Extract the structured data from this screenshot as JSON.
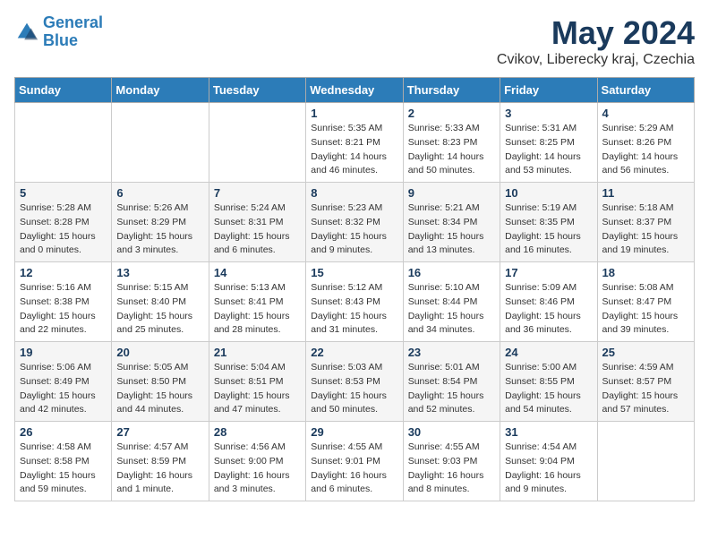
{
  "header": {
    "logo_line1": "General",
    "logo_line2": "Blue",
    "month": "May 2024",
    "location": "Cvikov, Liberecky kraj, Czechia"
  },
  "days_of_week": [
    "Sunday",
    "Monday",
    "Tuesday",
    "Wednesday",
    "Thursday",
    "Friday",
    "Saturday"
  ],
  "weeks": [
    [
      {
        "day": "",
        "info": ""
      },
      {
        "day": "",
        "info": ""
      },
      {
        "day": "",
        "info": ""
      },
      {
        "day": "1",
        "info": "Sunrise: 5:35 AM\nSunset: 8:21 PM\nDaylight: 14 hours\nand 46 minutes."
      },
      {
        "day": "2",
        "info": "Sunrise: 5:33 AM\nSunset: 8:23 PM\nDaylight: 14 hours\nand 50 minutes."
      },
      {
        "day": "3",
        "info": "Sunrise: 5:31 AM\nSunset: 8:25 PM\nDaylight: 14 hours\nand 53 minutes."
      },
      {
        "day": "4",
        "info": "Sunrise: 5:29 AM\nSunset: 8:26 PM\nDaylight: 14 hours\nand 56 minutes."
      }
    ],
    [
      {
        "day": "5",
        "info": "Sunrise: 5:28 AM\nSunset: 8:28 PM\nDaylight: 15 hours\nand 0 minutes."
      },
      {
        "day": "6",
        "info": "Sunrise: 5:26 AM\nSunset: 8:29 PM\nDaylight: 15 hours\nand 3 minutes."
      },
      {
        "day": "7",
        "info": "Sunrise: 5:24 AM\nSunset: 8:31 PM\nDaylight: 15 hours\nand 6 minutes."
      },
      {
        "day": "8",
        "info": "Sunrise: 5:23 AM\nSunset: 8:32 PM\nDaylight: 15 hours\nand 9 minutes."
      },
      {
        "day": "9",
        "info": "Sunrise: 5:21 AM\nSunset: 8:34 PM\nDaylight: 15 hours\nand 13 minutes."
      },
      {
        "day": "10",
        "info": "Sunrise: 5:19 AM\nSunset: 8:35 PM\nDaylight: 15 hours\nand 16 minutes."
      },
      {
        "day": "11",
        "info": "Sunrise: 5:18 AM\nSunset: 8:37 PM\nDaylight: 15 hours\nand 19 minutes."
      }
    ],
    [
      {
        "day": "12",
        "info": "Sunrise: 5:16 AM\nSunset: 8:38 PM\nDaylight: 15 hours\nand 22 minutes."
      },
      {
        "day": "13",
        "info": "Sunrise: 5:15 AM\nSunset: 8:40 PM\nDaylight: 15 hours\nand 25 minutes."
      },
      {
        "day": "14",
        "info": "Sunrise: 5:13 AM\nSunset: 8:41 PM\nDaylight: 15 hours\nand 28 minutes."
      },
      {
        "day": "15",
        "info": "Sunrise: 5:12 AM\nSunset: 8:43 PM\nDaylight: 15 hours\nand 31 minutes."
      },
      {
        "day": "16",
        "info": "Sunrise: 5:10 AM\nSunset: 8:44 PM\nDaylight: 15 hours\nand 34 minutes."
      },
      {
        "day": "17",
        "info": "Sunrise: 5:09 AM\nSunset: 8:46 PM\nDaylight: 15 hours\nand 36 minutes."
      },
      {
        "day": "18",
        "info": "Sunrise: 5:08 AM\nSunset: 8:47 PM\nDaylight: 15 hours\nand 39 minutes."
      }
    ],
    [
      {
        "day": "19",
        "info": "Sunrise: 5:06 AM\nSunset: 8:49 PM\nDaylight: 15 hours\nand 42 minutes."
      },
      {
        "day": "20",
        "info": "Sunrise: 5:05 AM\nSunset: 8:50 PM\nDaylight: 15 hours\nand 44 minutes."
      },
      {
        "day": "21",
        "info": "Sunrise: 5:04 AM\nSunset: 8:51 PM\nDaylight: 15 hours\nand 47 minutes."
      },
      {
        "day": "22",
        "info": "Sunrise: 5:03 AM\nSunset: 8:53 PM\nDaylight: 15 hours\nand 50 minutes."
      },
      {
        "day": "23",
        "info": "Sunrise: 5:01 AM\nSunset: 8:54 PM\nDaylight: 15 hours\nand 52 minutes."
      },
      {
        "day": "24",
        "info": "Sunrise: 5:00 AM\nSunset: 8:55 PM\nDaylight: 15 hours\nand 54 minutes."
      },
      {
        "day": "25",
        "info": "Sunrise: 4:59 AM\nSunset: 8:57 PM\nDaylight: 15 hours\nand 57 minutes."
      }
    ],
    [
      {
        "day": "26",
        "info": "Sunrise: 4:58 AM\nSunset: 8:58 PM\nDaylight: 15 hours\nand 59 minutes."
      },
      {
        "day": "27",
        "info": "Sunrise: 4:57 AM\nSunset: 8:59 PM\nDaylight: 16 hours\nand 1 minute."
      },
      {
        "day": "28",
        "info": "Sunrise: 4:56 AM\nSunset: 9:00 PM\nDaylight: 16 hours\nand 3 minutes."
      },
      {
        "day": "29",
        "info": "Sunrise: 4:55 AM\nSunset: 9:01 PM\nDaylight: 16 hours\nand 6 minutes."
      },
      {
        "day": "30",
        "info": "Sunrise: 4:55 AM\nSunset: 9:03 PM\nDaylight: 16 hours\nand 8 minutes."
      },
      {
        "day": "31",
        "info": "Sunrise: 4:54 AM\nSunset: 9:04 PM\nDaylight: 16 hours\nand 9 minutes."
      },
      {
        "day": "",
        "info": ""
      }
    ]
  ]
}
